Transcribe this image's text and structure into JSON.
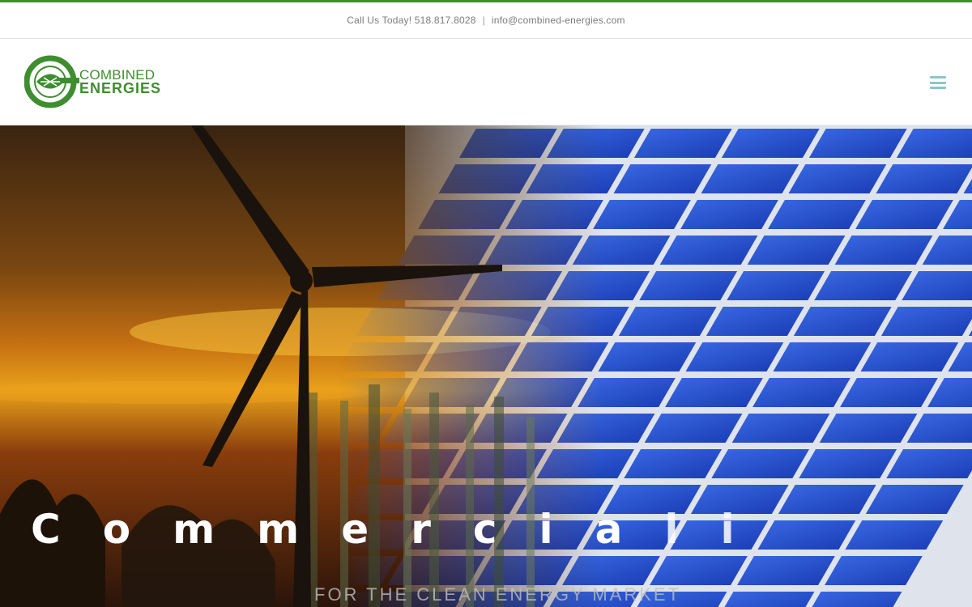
{
  "topbar": {
    "phone_text": "Call Us Today! 518.817.8028",
    "separator": "|",
    "email": "info@combined-energies.com"
  },
  "logo": {
    "line1": "COMBINED",
    "line2": "ENERGIES"
  },
  "hero": {
    "headline_letters": [
      "C",
      "o",
      "m",
      "m",
      "e",
      "r",
      "c",
      "i",
      "a",
      "l",
      "i"
    ],
    "subheadline": "FOR THE CLEAN ENERGY MARKET"
  },
  "colors": {
    "brand_green": "#3e8e2f",
    "menu_icon": "#8fc5c7",
    "panel_blue": "#1f48c9"
  }
}
